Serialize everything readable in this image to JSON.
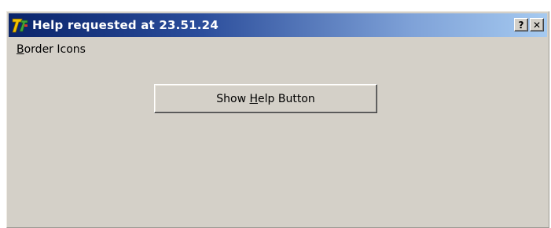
{
  "window": {
    "title": "Help requested at 23.51.24",
    "icon": "delphi-app-icon"
  },
  "caption_buttons": {
    "help_label": "?",
    "close_label": "✕"
  },
  "client": {
    "label_first": "B",
    "label_rest": "order Icons"
  },
  "button": {
    "prefix": "Show ",
    "accel": "H",
    "suffix": "elp Button"
  },
  "colors": {
    "window_face": "#d4d0c8",
    "titlebar_start": "#0a246a",
    "titlebar_end": "#a6caf0",
    "title_text": "#ffffff"
  }
}
